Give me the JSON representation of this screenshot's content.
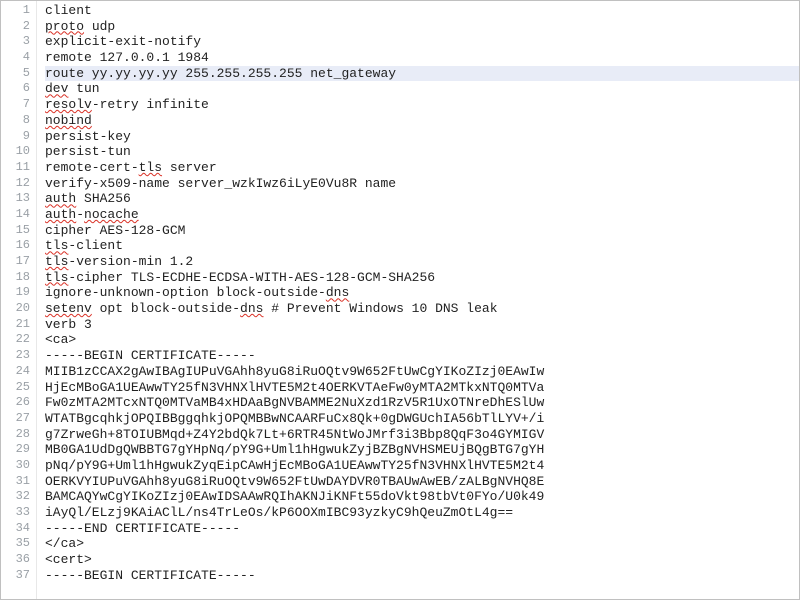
{
  "editor": {
    "current_line_index": 4,
    "lines": [
      {
        "n": 1,
        "segs": [
          {
            "t": "client"
          }
        ]
      },
      {
        "n": 2,
        "segs": [
          {
            "t": "proto",
            "u": 1
          },
          {
            "t": " udp"
          }
        ]
      },
      {
        "n": 3,
        "segs": [
          {
            "t": "explicit-exit-notify"
          }
        ]
      },
      {
        "n": 4,
        "segs": [
          {
            "t": "remote 127.0.0.1 1984"
          }
        ]
      },
      {
        "n": 5,
        "segs": [
          {
            "t": "route yy.yy.yy.yy 255.255.255.255 net_gateway"
          }
        ]
      },
      {
        "n": 6,
        "segs": [
          {
            "t": "dev",
            "u": 1
          },
          {
            "t": " tun"
          }
        ]
      },
      {
        "n": 7,
        "segs": [
          {
            "t": "resolv",
            "u": 1
          },
          {
            "t": "-retry infinite"
          }
        ]
      },
      {
        "n": 8,
        "segs": [
          {
            "t": "nobind",
            "u": 1
          }
        ]
      },
      {
        "n": 9,
        "segs": [
          {
            "t": "persist-key"
          }
        ]
      },
      {
        "n": 10,
        "segs": [
          {
            "t": "persist-tun"
          }
        ]
      },
      {
        "n": 11,
        "segs": [
          {
            "t": "remote-cert-"
          },
          {
            "t": "tls",
            "u": 1
          },
          {
            "t": " server"
          }
        ]
      },
      {
        "n": 12,
        "segs": [
          {
            "t": "verify-x509-name server_wzkIwz6iLyE0Vu8R name"
          }
        ]
      },
      {
        "n": 13,
        "segs": [
          {
            "t": "auth",
            "u": 1
          },
          {
            "t": " SHA256"
          }
        ]
      },
      {
        "n": 14,
        "segs": [
          {
            "t": "auth",
            "u": 1
          },
          {
            "t": "-"
          },
          {
            "t": "nocache",
            "u": 1
          }
        ]
      },
      {
        "n": 15,
        "segs": [
          {
            "t": "cipher AES-128-GCM"
          }
        ]
      },
      {
        "n": 16,
        "segs": [
          {
            "t": "tls",
            "u": 1
          },
          {
            "t": "-client"
          }
        ]
      },
      {
        "n": 17,
        "segs": [
          {
            "t": "tls",
            "u": 1
          },
          {
            "t": "-version-min 1.2"
          }
        ]
      },
      {
        "n": 18,
        "segs": [
          {
            "t": "tls",
            "u": 1
          },
          {
            "t": "-cipher TLS-ECDHE-ECDSA-WITH-AES-128-GCM-SHA256"
          }
        ]
      },
      {
        "n": 19,
        "segs": [
          {
            "t": "ignore-unknown-option block-outside-"
          },
          {
            "t": "dns",
            "u": 1
          }
        ]
      },
      {
        "n": 20,
        "segs": [
          {
            "t": "setenv",
            "u": 1
          },
          {
            "t": " opt block-outside-"
          },
          {
            "t": "dns",
            "u": 1
          },
          {
            "t": " # Prevent Windows 10 DNS leak"
          }
        ]
      },
      {
        "n": 21,
        "segs": [
          {
            "t": "verb 3"
          }
        ]
      },
      {
        "n": 22,
        "segs": [
          {
            "t": "<ca>"
          }
        ]
      },
      {
        "n": 23,
        "segs": [
          {
            "t": "-----BEGIN CERTIFICATE-----"
          }
        ]
      },
      {
        "n": 24,
        "segs": [
          {
            "t": "MIIB1zCCAX2gAwIBAgIUPuVGAhh8yuG8iRuOQtv9W652FtUwCgYIKoZIzj0EAwIw"
          }
        ]
      },
      {
        "n": 25,
        "segs": [
          {
            "t": "HjEcMBoGA1UEAwwTY25fN3VHNXlHVTE5M2t4OERKVTAeFw0yMTA2MTkxNTQ0MTVa"
          }
        ]
      },
      {
        "n": 26,
        "segs": [
          {
            "t": "Fw0zMTA2MTcxNTQ0MTVaMB4xHDAaBgNVBAMME2NuXzd1RzV5R1UxOTNreDhESlUw"
          }
        ]
      },
      {
        "n": 27,
        "segs": [
          {
            "t": "WTATBgcqhkjOPQIBBggqhkjOPQMBBwNCAARFuCx8Qk+0gDWGUchIA56bTlLYV+/i"
          }
        ]
      },
      {
        "n": 28,
        "segs": [
          {
            "t": "g7ZrweGh+8TOIUBMqd+Z4Y2bdQk7Lt+6RTR45NtWoJMrf3i3Bbp8QqF3o4GYMIGV"
          }
        ]
      },
      {
        "n": 29,
        "segs": [
          {
            "t": "MB0GA1UdDgQWBBTG7gYHpNq/pY9G+Uml1hHgwukZyjBZBgNVHSMEUjBQgBTG7gYH"
          }
        ]
      },
      {
        "n": 30,
        "segs": [
          {
            "t": "pNq/pY9G+Uml1hHgwukZyqEipCAwHjEcMBoGA1UEAwwTY25fN3VHNXlHVTE5M2t4"
          }
        ]
      },
      {
        "n": 31,
        "segs": [
          {
            "t": "OERKVYIUPuVGAhh8yuG8iRuOQtv9W652FtUwDAYDVR0TBAUwAwEB/zALBgNVHQ8E"
          }
        ]
      },
      {
        "n": 32,
        "segs": [
          {
            "t": "BAMCAQYwCgYIKoZIzj0EAwIDSAAwRQIhAKNJiKNFt55doVkt98tbVt0FYo/U0k49"
          }
        ]
      },
      {
        "n": 33,
        "segs": [
          {
            "t": "iAyQl/ELzj9KAiAClL/ns4TrLeOs/kP6OOXmIBC93yzkyC9hQeuZmOtL4g=="
          }
        ]
      },
      {
        "n": 34,
        "segs": [
          {
            "t": "-----END CERTIFICATE-----"
          }
        ]
      },
      {
        "n": 35,
        "segs": [
          {
            "t": "</ca>"
          }
        ]
      },
      {
        "n": 36,
        "segs": [
          {
            "t": "<cert>"
          }
        ]
      },
      {
        "n": 37,
        "segs": [
          {
            "t": "-----BEGIN CERTIFICATE-----"
          }
        ]
      }
    ]
  }
}
